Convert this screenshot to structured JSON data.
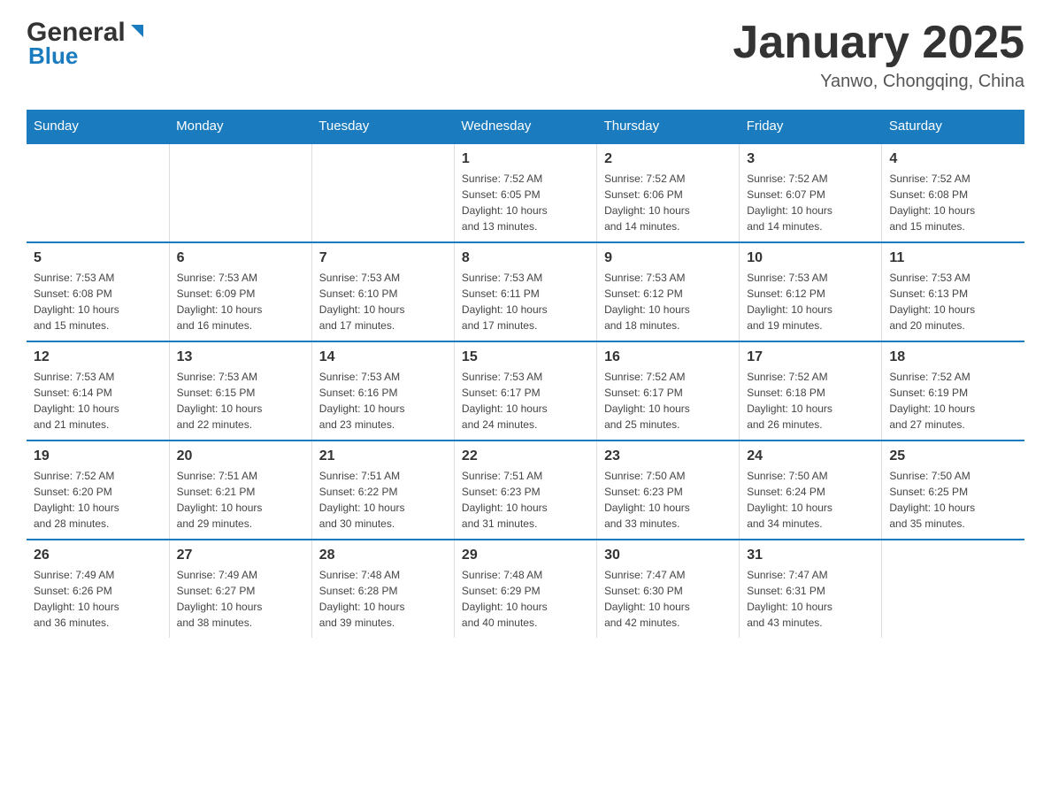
{
  "logo": {
    "text_general": "General",
    "text_blue": "Blue",
    "arrow_char": "▲"
  },
  "title": {
    "month_year": "January 2025",
    "location": "Yanwo, Chongqing, China"
  },
  "weekdays": [
    "Sunday",
    "Monday",
    "Tuesday",
    "Wednesday",
    "Thursday",
    "Friday",
    "Saturday"
  ],
  "weeks": [
    [
      {
        "day": "",
        "info": ""
      },
      {
        "day": "",
        "info": ""
      },
      {
        "day": "",
        "info": ""
      },
      {
        "day": "1",
        "info": "Sunrise: 7:52 AM\nSunset: 6:05 PM\nDaylight: 10 hours\nand 13 minutes."
      },
      {
        "day": "2",
        "info": "Sunrise: 7:52 AM\nSunset: 6:06 PM\nDaylight: 10 hours\nand 14 minutes."
      },
      {
        "day": "3",
        "info": "Sunrise: 7:52 AM\nSunset: 6:07 PM\nDaylight: 10 hours\nand 14 minutes."
      },
      {
        "day": "4",
        "info": "Sunrise: 7:52 AM\nSunset: 6:08 PM\nDaylight: 10 hours\nand 15 minutes."
      }
    ],
    [
      {
        "day": "5",
        "info": "Sunrise: 7:53 AM\nSunset: 6:08 PM\nDaylight: 10 hours\nand 15 minutes."
      },
      {
        "day": "6",
        "info": "Sunrise: 7:53 AM\nSunset: 6:09 PM\nDaylight: 10 hours\nand 16 minutes."
      },
      {
        "day": "7",
        "info": "Sunrise: 7:53 AM\nSunset: 6:10 PM\nDaylight: 10 hours\nand 17 minutes."
      },
      {
        "day": "8",
        "info": "Sunrise: 7:53 AM\nSunset: 6:11 PM\nDaylight: 10 hours\nand 17 minutes."
      },
      {
        "day": "9",
        "info": "Sunrise: 7:53 AM\nSunset: 6:12 PM\nDaylight: 10 hours\nand 18 minutes."
      },
      {
        "day": "10",
        "info": "Sunrise: 7:53 AM\nSunset: 6:12 PM\nDaylight: 10 hours\nand 19 minutes."
      },
      {
        "day": "11",
        "info": "Sunrise: 7:53 AM\nSunset: 6:13 PM\nDaylight: 10 hours\nand 20 minutes."
      }
    ],
    [
      {
        "day": "12",
        "info": "Sunrise: 7:53 AM\nSunset: 6:14 PM\nDaylight: 10 hours\nand 21 minutes."
      },
      {
        "day": "13",
        "info": "Sunrise: 7:53 AM\nSunset: 6:15 PM\nDaylight: 10 hours\nand 22 minutes."
      },
      {
        "day": "14",
        "info": "Sunrise: 7:53 AM\nSunset: 6:16 PM\nDaylight: 10 hours\nand 23 minutes."
      },
      {
        "day": "15",
        "info": "Sunrise: 7:53 AM\nSunset: 6:17 PM\nDaylight: 10 hours\nand 24 minutes."
      },
      {
        "day": "16",
        "info": "Sunrise: 7:52 AM\nSunset: 6:17 PM\nDaylight: 10 hours\nand 25 minutes."
      },
      {
        "day": "17",
        "info": "Sunrise: 7:52 AM\nSunset: 6:18 PM\nDaylight: 10 hours\nand 26 minutes."
      },
      {
        "day": "18",
        "info": "Sunrise: 7:52 AM\nSunset: 6:19 PM\nDaylight: 10 hours\nand 27 minutes."
      }
    ],
    [
      {
        "day": "19",
        "info": "Sunrise: 7:52 AM\nSunset: 6:20 PM\nDaylight: 10 hours\nand 28 minutes."
      },
      {
        "day": "20",
        "info": "Sunrise: 7:51 AM\nSunset: 6:21 PM\nDaylight: 10 hours\nand 29 minutes."
      },
      {
        "day": "21",
        "info": "Sunrise: 7:51 AM\nSunset: 6:22 PM\nDaylight: 10 hours\nand 30 minutes."
      },
      {
        "day": "22",
        "info": "Sunrise: 7:51 AM\nSunset: 6:23 PM\nDaylight: 10 hours\nand 31 minutes."
      },
      {
        "day": "23",
        "info": "Sunrise: 7:50 AM\nSunset: 6:23 PM\nDaylight: 10 hours\nand 33 minutes."
      },
      {
        "day": "24",
        "info": "Sunrise: 7:50 AM\nSunset: 6:24 PM\nDaylight: 10 hours\nand 34 minutes."
      },
      {
        "day": "25",
        "info": "Sunrise: 7:50 AM\nSunset: 6:25 PM\nDaylight: 10 hours\nand 35 minutes."
      }
    ],
    [
      {
        "day": "26",
        "info": "Sunrise: 7:49 AM\nSunset: 6:26 PM\nDaylight: 10 hours\nand 36 minutes."
      },
      {
        "day": "27",
        "info": "Sunrise: 7:49 AM\nSunset: 6:27 PM\nDaylight: 10 hours\nand 38 minutes."
      },
      {
        "day": "28",
        "info": "Sunrise: 7:48 AM\nSunset: 6:28 PM\nDaylight: 10 hours\nand 39 minutes."
      },
      {
        "day": "29",
        "info": "Sunrise: 7:48 AM\nSunset: 6:29 PM\nDaylight: 10 hours\nand 40 minutes."
      },
      {
        "day": "30",
        "info": "Sunrise: 7:47 AM\nSunset: 6:30 PM\nDaylight: 10 hours\nand 42 minutes."
      },
      {
        "day": "31",
        "info": "Sunrise: 7:47 AM\nSunset: 6:31 PM\nDaylight: 10 hours\nand 43 minutes."
      },
      {
        "day": "",
        "info": ""
      }
    ]
  ]
}
